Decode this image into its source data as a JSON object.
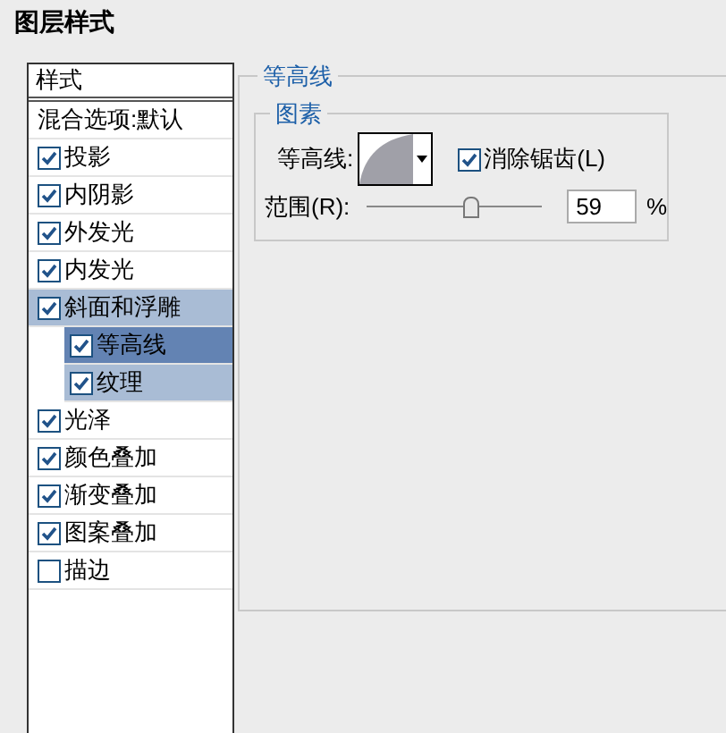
{
  "window": {
    "title": "图层样式"
  },
  "sidebar": {
    "header": "样式",
    "items": [
      {
        "label": "混合选项:默认",
        "kind": "plain",
        "selected": false
      },
      {
        "label": "投影",
        "kind": "check",
        "checked": true,
        "selected": false
      },
      {
        "label": "内阴影",
        "kind": "check",
        "checked": true,
        "selected": false
      },
      {
        "label": "外发光",
        "kind": "check",
        "checked": true,
        "selected": false
      },
      {
        "label": "内发光",
        "kind": "check",
        "checked": true,
        "selected": false
      },
      {
        "label": "斜面和浮雕",
        "kind": "check",
        "checked": true,
        "selected": false,
        "children": [
          {
            "label": "等高线",
            "kind": "check",
            "checked": true,
            "selected": true
          },
          {
            "label": "纹理",
            "kind": "check",
            "checked": true,
            "selected": false
          }
        ]
      },
      {
        "label": "光泽",
        "kind": "check",
        "checked": true,
        "selected": false
      },
      {
        "label": "颜色叠加",
        "kind": "check",
        "checked": true,
        "selected": false
      },
      {
        "label": "渐变叠加",
        "kind": "check",
        "checked": true,
        "selected": false
      },
      {
        "label": "图案叠加",
        "kind": "check",
        "checked": true,
        "selected": false
      },
      {
        "label": "描边",
        "kind": "check",
        "checked": false,
        "selected": false
      }
    ]
  },
  "panel": {
    "title": "等高线",
    "group": {
      "title": "图素",
      "contour": {
        "label": "等高线:"
      },
      "anti_alias": {
        "label": "消除锯齿(L)",
        "checked": true
      },
      "range": {
        "label": "范围(R):",
        "level": 0.59,
        "value": "59",
        "unit": "%"
      }
    }
  }
}
